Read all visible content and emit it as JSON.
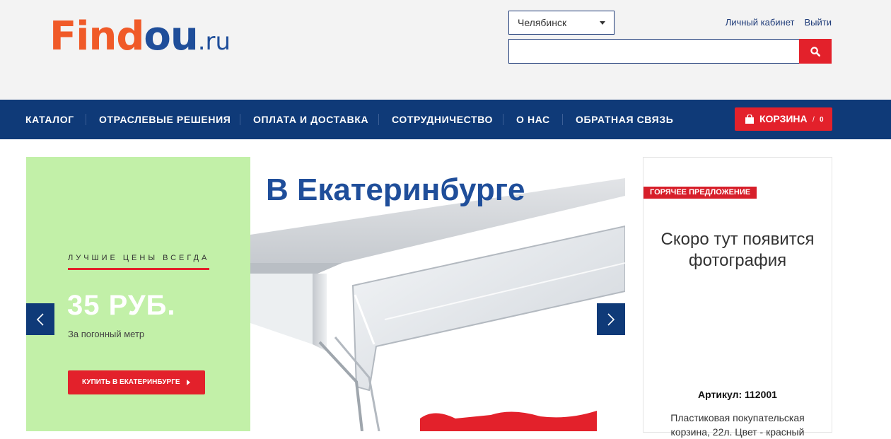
{
  "logo": {
    "part1": "Find",
    "part2": "ou",
    "tld": ".ru"
  },
  "header": {
    "city": "Челябинск",
    "account_label": "Личный кабинет",
    "logout_label": "Выйти",
    "search_placeholder": ""
  },
  "nav": {
    "items": [
      {
        "label": "КАТАЛОГ"
      },
      {
        "label": "ОТРАСЛЕВЫЕ РЕШЕНИЯ"
      },
      {
        "label": "ОПЛАТА И ДОСТАВКА"
      },
      {
        "label": "СОТРУДНИЧЕСТВО"
      },
      {
        "label": "О НАС"
      },
      {
        "label": "ОБРАТНАЯ СВЯЗЬ"
      }
    ],
    "cart_label": "КОРЗИНА",
    "cart_separator": "/",
    "cart_count": "0"
  },
  "slider": {
    "tagline": "ЛУЧШИЕ ЦЕНЫ ВСЕГДА",
    "price": "35 РУБ.",
    "unit": "За погонный метр",
    "buy_label": "КУПИТЬ В ЕКАТЕРИНБУРГЕ",
    "headline": "В Екатеринбурге"
  },
  "offer": {
    "badge": "ГОРЯЧЕЕ ПРЕДЛОЖЕНИЕ",
    "placeholder": "Скоро тут появится фотография",
    "article": "Артикул: 112001",
    "description": "Пластиковая покупательская корзина, 22л. Цвет - красный"
  },
  "colors": {
    "brand_blue": "#0f3a78",
    "accent_red": "#e3212b",
    "slide_green": "#c2f0a8"
  }
}
